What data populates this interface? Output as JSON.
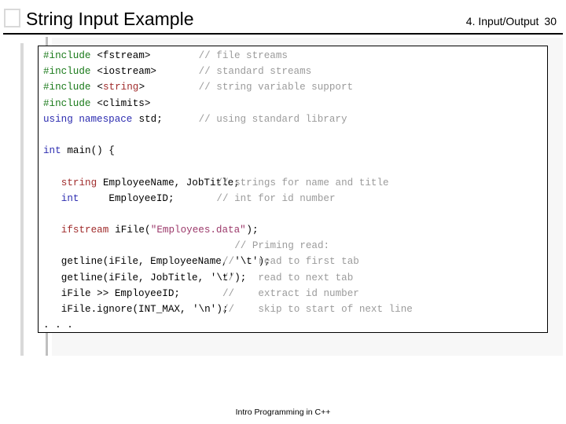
{
  "header": {
    "title": "String Input Example",
    "section": "4. Input/Output",
    "page_number": "30"
  },
  "footer": {
    "text": "Intro Programming in C++"
  },
  "colors": {
    "preprocessor": "#1a7a1a",
    "keyword": "#2c2cb0",
    "type": "#a02c2c",
    "string_literal": "#9c3a6b",
    "comment": "#9b9b9b",
    "plain": "#000000",
    "rule": "#000000",
    "panel_background": "#f7f7f7",
    "decoration": "#d9d9d9"
  },
  "code": {
    "language": "C++",
    "lines": [
      {
        "col": 1,
        "segments": [
          {
            "text": "#include",
            "kind": "pre"
          },
          {
            "text": " <fstream>",
            "kind": "plain"
          }
        ],
        "comment": {
          "col": 27,
          "text": "// file streams"
        }
      },
      {
        "col": 1,
        "segments": [
          {
            "text": "#include",
            "kind": "pre"
          },
          {
            "text": " <iostream>",
            "kind": "plain"
          }
        ],
        "comment": {
          "col": 27,
          "text": "// standard streams"
        }
      },
      {
        "col": 1,
        "segments": [
          {
            "text": "#include",
            "kind": "pre"
          },
          {
            "text": " <",
            "kind": "plain"
          },
          {
            "text": "string",
            "kind": "type"
          },
          {
            "text": ">",
            "kind": "plain"
          }
        ],
        "comment": {
          "col": 27,
          "text": "// string variable support"
        }
      },
      {
        "col": 1,
        "segments": [
          {
            "text": "#include",
            "kind": "pre"
          },
          {
            "text": " <climits>",
            "kind": "plain"
          }
        ],
        "comment": null
      },
      {
        "col": 1,
        "segments": [
          {
            "text": "using namespace",
            "kind": "kw"
          },
          {
            "text": " std;",
            "kind": "plain"
          }
        ],
        "comment": {
          "col": 27,
          "text": "// using standard library"
        }
      },
      {
        "col": 1,
        "segments": [],
        "comment": null
      },
      {
        "col": 1,
        "segments": [
          {
            "text": "int",
            "kind": "kw"
          },
          {
            "text": " main() {",
            "kind": "plain"
          }
        ],
        "comment": null
      },
      {
        "col": 1,
        "segments": [],
        "comment": null
      },
      {
        "col": 4,
        "segments": [
          {
            "text": "string",
            "kind": "type"
          },
          {
            "text": " EmployeeName, JobTitle;",
            "kind": "plain"
          }
        ],
        "comment": {
          "col": 30,
          "text": "// strings for name and title"
        }
      },
      {
        "col": 4,
        "segments": [
          {
            "text": "int",
            "kind": "kw"
          },
          {
            "text": "     EmployeeID;",
            "kind": "plain"
          }
        ],
        "comment": {
          "col": 30,
          "text": "// int for id number"
        }
      },
      {
        "col": 1,
        "segments": [],
        "comment": null
      },
      {
        "col": 4,
        "segments": [
          {
            "text": "ifstream",
            "kind": "type"
          },
          {
            "text": " iFile(",
            "kind": "plain"
          },
          {
            "text": "\"Employees.data\"",
            "kind": "str"
          },
          {
            "text": ");",
            "kind": "plain"
          }
        ],
        "comment": null
      },
      {
        "col": 1,
        "segments": [],
        "comment": {
          "col": 33,
          "text": "// Priming read:"
        }
      },
      {
        "col": 4,
        "segments": [
          {
            "text": "getline(iFile, EmployeeName, ",
            "kind": "plain"
          },
          {
            "text": "'\\t'",
            "kind": "plain"
          },
          {
            "text": ");",
            "kind": "plain"
          }
        ],
        "comment": {
          "col": 31,
          "text": "//    read to first tab"
        }
      },
      {
        "col": 4,
        "segments": [
          {
            "text": "getline(iFile, JobTitle, ",
            "kind": "plain"
          },
          {
            "text": "'\\t'",
            "kind": "plain"
          },
          {
            "text": ");",
            "kind": "plain"
          }
        ],
        "comment": {
          "col": 31,
          "text": "//    read to next tab"
        }
      },
      {
        "col": 4,
        "segments": [
          {
            "text": "iFile >> EmployeeID;",
            "kind": "plain"
          }
        ],
        "comment": {
          "col": 31,
          "text": "//    extract id number"
        }
      },
      {
        "col": 4,
        "segments": [
          {
            "text": "iFile.ignore(INT_MAX, ",
            "kind": "plain"
          },
          {
            "text": "'\\n'",
            "kind": "plain"
          },
          {
            "text": ");",
            "kind": "plain"
          }
        ],
        "comment": {
          "col": 31,
          "text": "//    skip to start of next line"
        }
      },
      {
        "col": 1,
        "segments": [
          {
            "text": ". . .",
            "kind": "plain"
          }
        ],
        "comment": null
      }
    ]
  }
}
